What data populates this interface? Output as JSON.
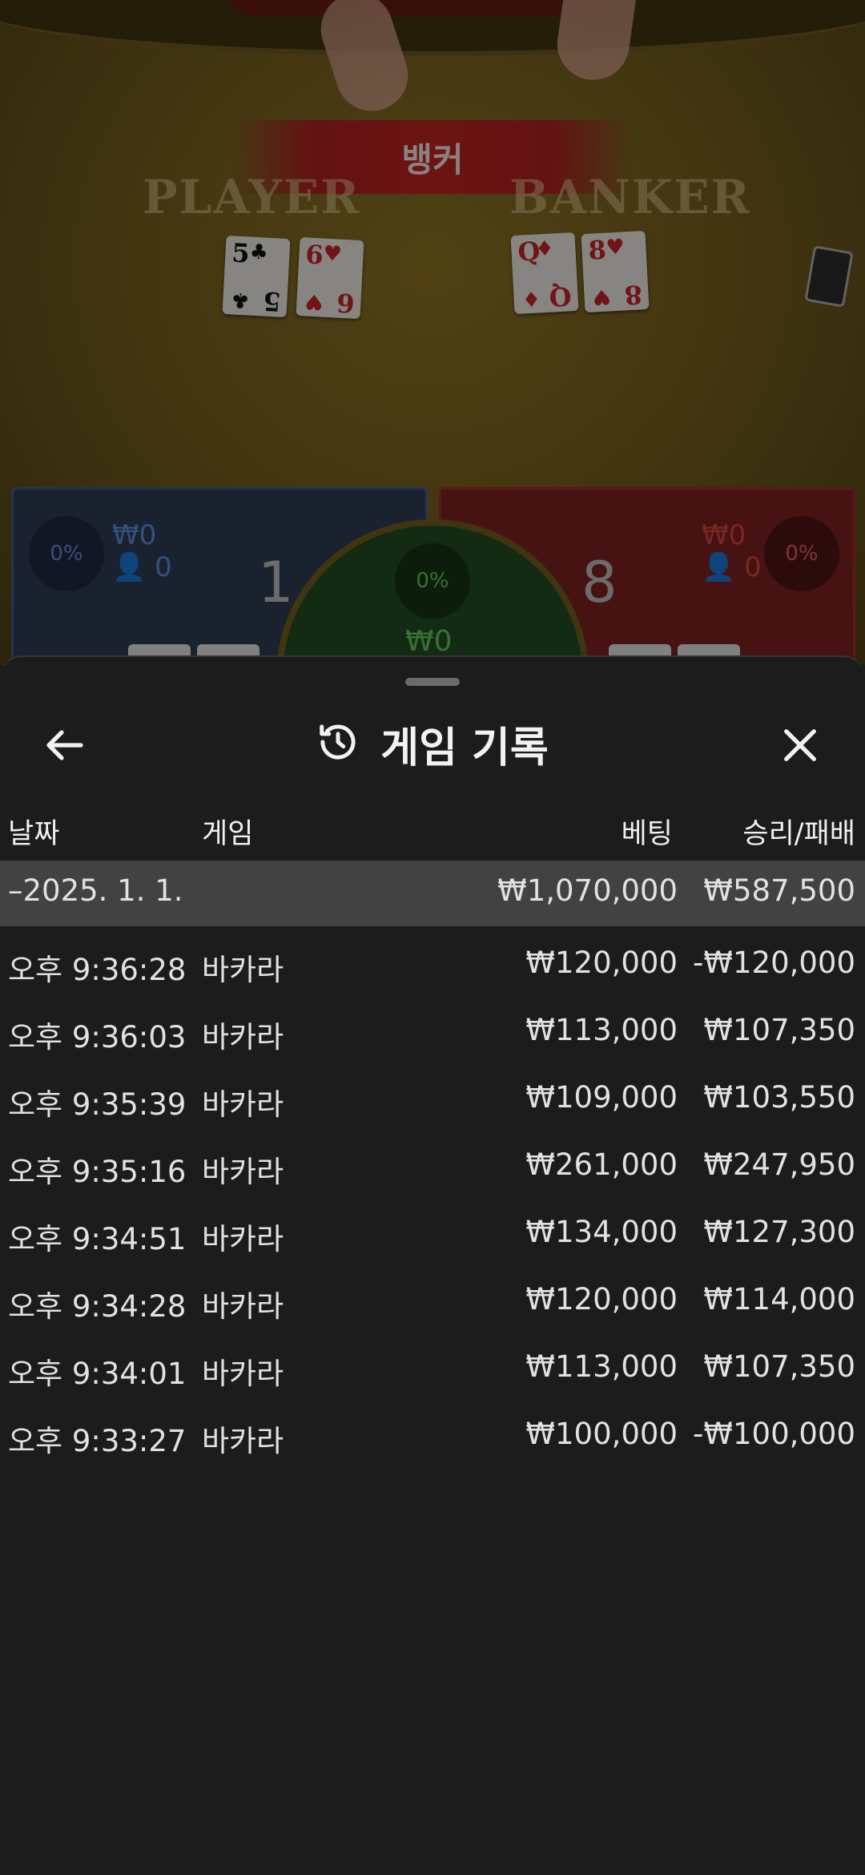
{
  "table": {
    "result_banner": "뱅커",
    "player_label": "PLAYER",
    "banker_label": "BANKER",
    "player_cards": [
      {
        "rank": "5",
        "suit": "♣",
        "color": "black"
      },
      {
        "rank": "6",
        "suit": "♥",
        "color": "red"
      }
    ],
    "banker_cards": [
      {
        "rank": "Q",
        "suit": "♦",
        "color": "red"
      },
      {
        "rank": "8",
        "suit": "♥",
        "color": "red"
      }
    ],
    "player": {
      "percent": "0%",
      "stake": "₩0",
      "players": "0",
      "score": "1"
    },
    "banker": {
      "percent": "0%",
      "stake": "₩0",
      "players": "0",
      "score": "8"
    },
    "tie": {
      "percent": "0%",
      "stake": "₩0"
    },
    "colors": {
      "player": "#3f5c91",
      "banker": "#9c2a26",
      "tie": "#224a20"
    }
  },
  "history": {
    "title": "게임 기록",
    "icons": {
      "back": "arrow-left-icon",
      "title": "history-icon",
      "close": "close-icon"
    },
    "columns": {
      "date": "날짜",
      "game": "게임",
      "bet": "베팅",
      "result": "승리/패배"
    },
    "summary": {
      "date": "–2025. 1. 1.",
      "bet": "₩1,070,000",
      "result": "₩587,500"
    },
    "rows": [
      {
        "time": "오후 9:36:28",
        "game": "바카라",
        "bet": "₩120,000",
        "result": "-₩120,000"
      },
      {
        "time": "오후 9:36:03",
        "game": "바카라",
        "bet": "₩113,000",
        "result": "₩107,350"
      },
      {
        "time": "오후 9:35:39",
        "game": "바카라",
        "bet": "₩109,000",
        "result": "₩103,550"
      },
      {
        "time": "오후 9:35:16",
        "game": "바카라",
        "bet": "₩261,000",
        "result": "₩247,950"
      },
      {
        "time": "오후 9:34:51",
        "game": "바카라",
        "bet": "₩134,000",
        "result": "₩127,300"
      },
      {
        "time": "오후 9:34:28",
        "game": "바카라",
        "bet": "₩120,000",
        "result": "₩114,000"
      },
      {
        "time": "오후 9:34:01",
        "game": "바카라",
        "bet": "₩113,000",
        "result": "₩107,350"
      },
      {
        "time": "오후 9:33:27",
        "game": "바카라",
        "bet": "₩100,000",
        "result": "-₩100,000"
      }
    ]
  }
}
